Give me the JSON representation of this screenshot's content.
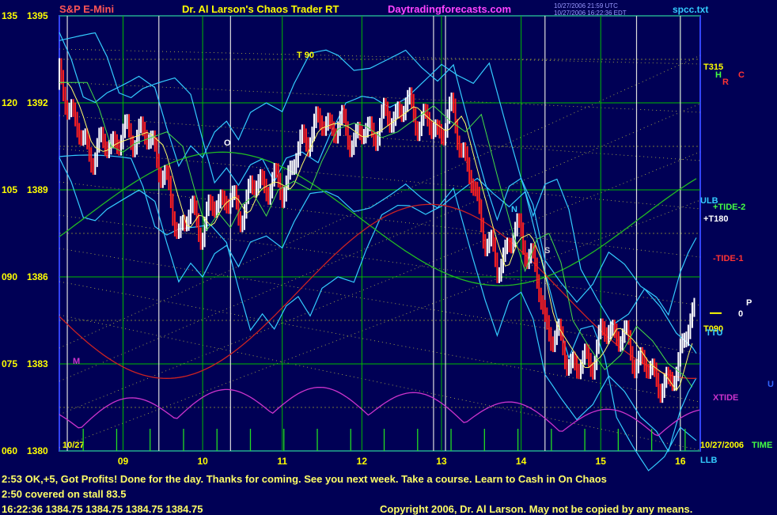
{
  "header": {
    "symbol": "S&P E-Mini",
    "title": "Dr. Al Larson's Chaos Trader RT",
    "website": "Daytradingforecasts.com",
    "stamp_utc": "10/27/2006 21:59 UTC",
    "stamp_local": "10/27/2006 16:22:36 EDT",
    "filename": "spcc.txt"
  },
  "messages": [
    "2:53 OK,+5,  Got Profits! Done for the day. Thanks for coming. See you next week. Take a course. Learn to Cash in On Chaos",
    "2:50 covered on stall 83.5"
  ],
  "status_line": "16:22:36  1384.75 1384.75 1384.75 1384.75",
  "copyright": "Copyright 2006, Dr. Al Larson. May not be copied by any means.",
  "colors": {
    "background": "#000055",
    "grid": "#00bb00",
    "up_bar": "#ffffff",
    "down_bar": "#ff2020",
    "axis_text": "#ffff00",
    "cyan": "#33ccff",
    "magenta": "#cc33cc",
    "green_line": "#22bb22",
    "red_line": "#cc2222"
  },
  "chart_data": {
    "type": "line",
    "x_ticks": [
      "09",
      "10",
      "11",
      "12",
      "13",
      "14",
      "15",
      "16"
    ],
    "x_start_label": "10/27",
    "x_end_label": "10/27/2006",
    "y_left_ticks": [
      "135",
      "120",
      "105",
      "090",
      "075",
      "060"
    ],
    "y_right_ticks": [
      "1395",
      "1392",
      "1389",
      "1386",
      "1383",
      "1380"
    ],
    "ylim": [
      1380,
      1395
    ],
    "x_range_hours": [
      8.2,
      16.25
    ],
    "grid": true,
    "price": [
      [
        8.2,
        1392.7
      ],
      [
        8.35,
        1391.8
      ],
      [
        8.5,
        1390.5
      ],
      [
        8.65,
        1390.3
      ],
      [
        8.8,
        1390.6
      ],
      [
        9.0,
        1390.8
      ],
      [
        9.2,
        1391.0
      ],
      [
        9.4,
        1390.5
      ],
      [
        9.55,
        1389.0
      ],
      [
        9.7,
        1387.6
      ],
      [
        9.85,
        1388.2
      ],
      [
        10.0,
        1387.7
      ],
      [
        10.15,
        1388.5
      ],
      [
        10.3,
        1388.8
      ],
      [
        10.45,
        1388.1
      ],
      [
        10.6,
        1389.0
      ],
      [
        10.8,
        1389.3
      ],
      [
        11.0,
        1389.0
      ],
      [
        11.15,
        1390.0
      ],
      [
        11.35,
        1391.1
      ],
      [
        11.55,
        1391.3
      ],
      [
        11.7,
        1391.2
      ],
      [
        11.9,
        1390.8
      ],
      [
        12.1,
        1391.0
      ],
      [
        12.35,
        1391.5
      ],
      [
        12.55,
        1391.9
      ],
      [
        12.75,
        1391.4
      ],
      [
        12.95,
        1391.0
      ],
      [
        13.15,
        1391.6
      ],
      [
        13.35,
        1389.5
      ],
      [
        13.55,
        1387.5
      ],
      [
        13.7,
        1386.2
      ],
      [
        13.85,
        1387.3
      ],
      [
        14.0,
        1387.5
      ],
      [
        14.15,
        1386.5
      ],
      [
        14.3,
        1384.5
      ],
      [
        14.5,
        1383.6
      ],
      [
        14.7,
        1382.8
      ],
      [
        14.9,
        1383.3
      ],
      [
        15.1,
        1384.3
      ],
      [
        15.3,
        1383.8
      ],
      [
        15.5,
        1383.0
      ],
      [
        15.7,
        1382.6
      ],
      [
        15.85,
        1382.0
      ],
      [
        16.0,
        1383.5
      ],
      [
        16.1,
        1384.2
      ],
      [
        16.2,
        1384.75
      ]
    ],
    "vertical_lines": [
      8.3,
      9.45,
      10.35,
      12.9,
      13.05,
      14.3,
      15.45,
      16.0
    ],
    "last_price": 1384.75,
    "annotations": [
      {
        "text": "T 90",
        "color": "#ffff00"
      },
      {
        "text": "T315",
        "color": "#ffff00"
      },
      {
        "text": "+T180",
        "color": "#ffffff"
      },
      {
        "text": "T090",
        "color": "#ffff00"
      },
      {
        "text": "+TIDE-2",
        "color": "#44ff44"
      },
      {
        "text": "-TIDE-1",
        "color": "#ff3333"
      },
      {
        "text": "ULB",
        "color": "#33ccff"
      },
      {
        "text": "LLB",
        "color": "#33ccff"
      },
      {
        "text": "TTU",
        "color": "#33ccff"
      },
      {
        "text": "XTIDE",
        "color": "#cc33cc"
      },
      {
        "text": "TIME",
        "color": "#44ff44"
      },
      {
        "text": "H",
        "color": "#44ff44"
      },
      {
        "text": "R",
        "color": "#ff3333"
      },
      {
        "text": "C",
        "color": "#ff3333"
      },
      {
        "text": "P",
        "color": "#ffffff"
      },
      {
        "text": "0",
        "color": "#ffffff"
      },
      {
        "text": "N",
        "color": "#33ccff"
      },
      {
        "text": "S",
        "color": "#cccccc"
      },
      {
        "text": "O",
        "color": "#ffffff"
      },
      {
        "text": "M",
        "color": "#cc33cc"
      },
      {
        "text": "U",
        "color": "#3366ff"
      }
    ]
  }
}
